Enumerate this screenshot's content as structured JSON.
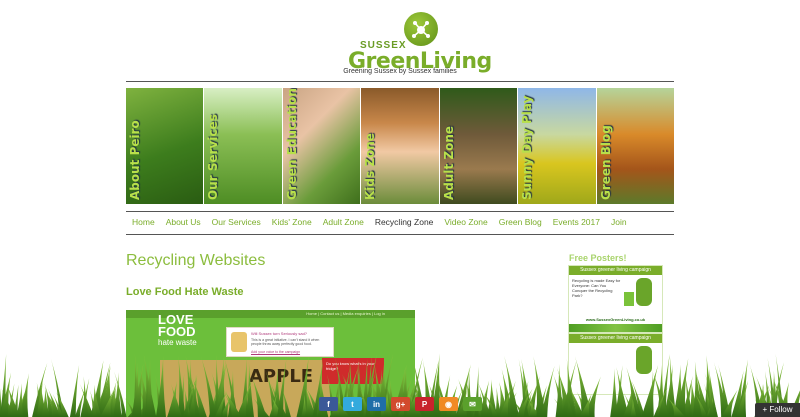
{
  "header": {
    "logo_small": "SUSSEX",
    "logo_main": "GreenLiving",
    "tagline": "Greening Sussex by Sussex families"
  },
  "banner": [
    {
      "label": "About Peiro"
    },
    {
      "label": "Our Services"
    },
    {
      "label": "Green Education"
    },
    {
      "label": "Kids Zone"
    },
    {
      "label": "Adult Zone"
    },
    {
      "label": "Sunny Day Play"
    },
    {
      "label": "Green Blog"
    }
  ],
  "nav": {
    "items": [
      {
        "label": "Home"
      },
      {
        "label": "About Us"
      },
      {
        "label": "Our Services"
      },
      {
        "label": "Kids' Zone"
      },
      {
        "label": "Adult Zone"
      },
      {
        "label": "Recycling Zone"
      },
      {
        "label": "Video Zone"
      },
      {
        "label": "Green Blog"
      },
      {
        "label": "Events 2017"
      },
      {
        "label": "Join"
      }
    ],
    "active": "Recycling Zone"
  },
  "main": {
    "title": "Recycling Websites",
    "subtitle": "Love Food Hate Waste",
    "screenshot": {
      "nav": "Home | Contact us | Media enquiries | Log in",
      "logo_line1": "LOVE",
      "logo_line2": "FOOD",
      "logo_line3": "hate waste",
      "card_title": "Will Sussex turn Seriously sad?",
      "card_body": "This is a great initiative. I can't stand it when people throw away perfectly good food.",
      "card_link": "Add your voice to the campaign",
      "apple_text": "APPLE",
      "red_text": "Do you know what's in your fridge?"
    }
  },
  "sidebar": {
    "title": "Free Posters!",
    "posters": [
      {
        "header": "Sussex greener living campaign",
        "text": "Recycling is made Easy for Everyone: Can You Conquer the Recycling Park?",
        "url": "www.SussexGreenLiving.co.uk"
      },
      {
        "header": "Sussex greener living campaign",
        "text": "",
        "url": ""
      }
    ]
  },
  "social": {
    "icons": [
      {
        "name": "facebook-icon",
        "color": "#3b5998",
        "glyph": "f"
      },
      {
        "name": "twitter-icon",
        "color": "#33aadd",
        "glyph": "t"
      },
      {
        "name": "linkedin-icon",
        "color": "#1f6ea8",
        "glyph": "in"
      },
      {
        "name": "googleplus-icon",
        "color": "#d24a2d",
        "glyph": "g+"
      },
      {
        "name": "pinterest-icon",
        "color": "#c8232c",
        "glyph": "P"
      },
      {
        "name": "rss-icon",
        "color": "#f08a24",
        "glyph": "◉"
      },
      {
        "name": "email-icon",
        "color": "#5aa02c",
        "glyph": "✉"
      }
    ]
  },
  "follow": {
    "label": "+ Follow"
  },
  "colors": {
    "accent": "#7aad2a",
    "title_green": "#8cbd3e"
  }
}
